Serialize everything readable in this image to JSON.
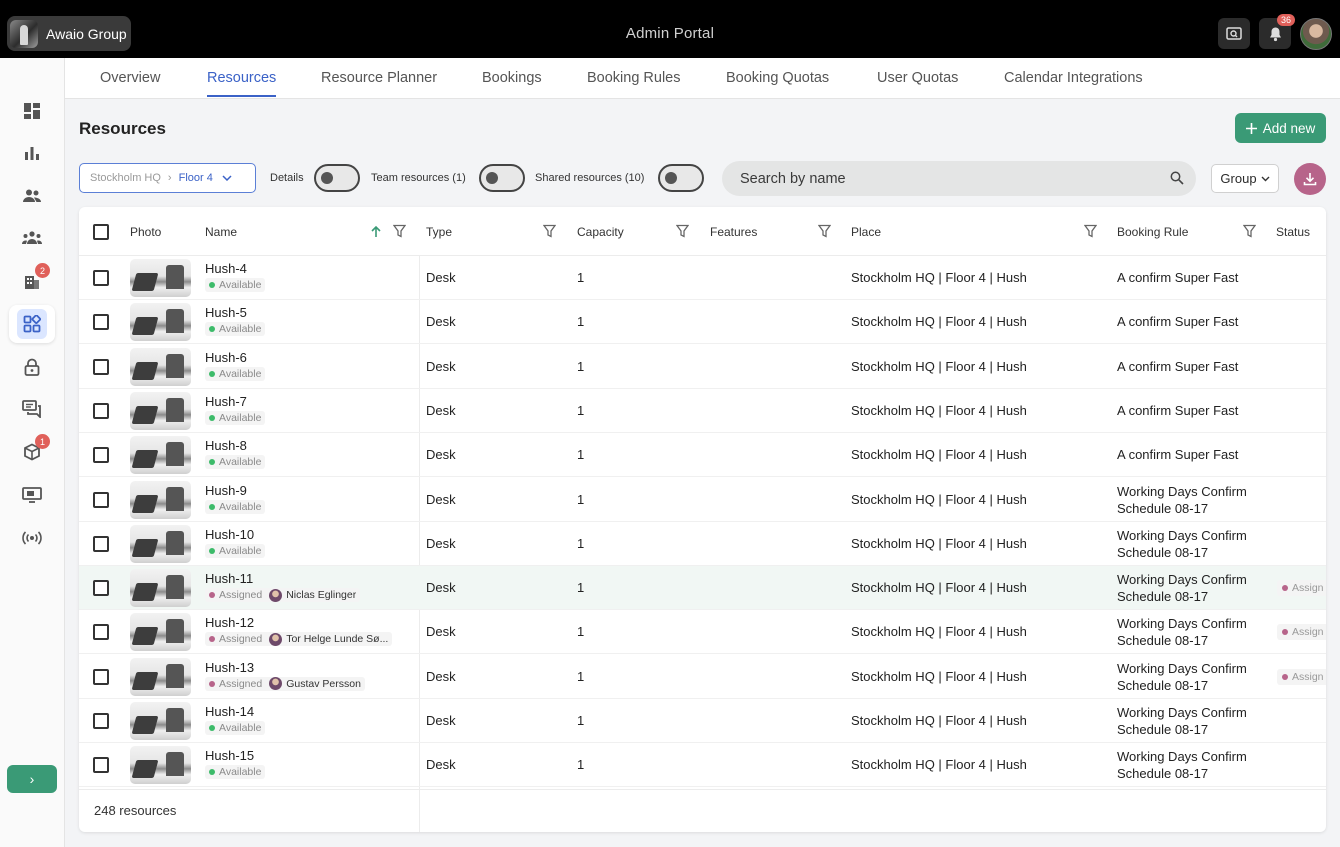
{
  "topbar": {
    "org_name": "Awaio Group",
    "portal_title": "Admin Portal",
    "notification_count": "36"
  },
  "sidebar": {
    "items": [
      {
        "icon": "dashboard-icon"
      },
      {
        "icon": "bar-chart-icon"
      },
      {
        "icon": "users-icon"
      },
      {
        "icon": "team-icon"
      },
      {
        "icon": "building-icon",
        "badge": "2"
      },
      {
        "icon": "resources-icon",
        "active": true
      },
      {
        "icon": "lock-icon"
      },
      {
        "icon": "chat-icon"
      },
      {
        "icon": "package-icon",
        "badge": "1"
      },
      {
        "icon": "screen-icon"
      },
      {
        "icon": "broadcast-icon"
      }
    ],
    "expand_label": "›"
  },
  "tabs": [
    "Overview",
    "Resources",
    "Resource Planner",
    "Bookings",
    "Booking Rules",
    "Booking Quotas",
    "User Quotas",
    "Calendar Integrations"
  ],
  "active_tab": "Resources",
  "page": {
    "title": "Resources",
    "add_new_label": "Add new"
  },
  "filters": {
    "breadcrumb_a": "Stockholm HQ",
    "breadcrumb_b": "Floor 4",
    "details_label": "Details",
    "team_label": "Team resources (1)",
    "shared_label": "Shared resources (10)",
    "search_placeholder": "Search by name",
    "group_label": "Group"
  },
  "table": {
    "columns": {
      "photo": "Photo",
      "name": "Name",
      "type": "Type",
      "capacity": "Capacity",
      "features": "Features",
      "place": "Place",
      "booking_rule": "Booking Rule",
      "status": "Status"
    },
    "rows": [
      {
        "name": "Hush-4",
        "status": "Available",
        "type": "Desk",
        "capacity": "1",
        "place": "Stockholm HQ | Floor 4 | Hush",
        "rule": "A confirm Super Fast"
      },
      {
        "name": "Hush-5",
        "status": "Available",
        "type": "Desk",
        "capacity": "1",
        "place": "Stockholm HQ | Floor 4 | Hush",
        "rule": "A confirm Super Fast"
      },
      {
        "name": "Hush-6",
        "status": "Available",
        "type": "Desk",
        "capacity": "1",
        "place": "Stockholm HQ | Floor 4 | Hush",
        "rule": "A confirm Super Fast"
      },
      {
        "name": "Hush-7",
        "status": "Available",
        "type": "Desk",
        "capacity": "1",
        "place": "Stockholm HQ | Floor 4 | Hush",
        "rule": "A confirm Super Fast"
      },
      {
        "name": "Hush-8",
        "status": "Available",
        "type": "Desk",
        "capacity": "1",
        "place": "Stockholm HQ | Floor 4 | Hush",
        "rule": "A confirm Super Fast"
      },
      {
        "name": "Hush-9",
        "status": "Available",
        "type": "Desk",
        "capacity": "1",
        "place": "Stockholm HQ | Floor 4 | Hush",
        "rule": "Working Days Confirm Schedule 08-17"
      },
      {
        "name": "Hush-10",
        "status": "Available",
        "type": "Desk",
        "capacity": "1",
        "place": "Stockholm HQ | Floor 4 | Hush",
        "rule": "Working Days Confirm Schedule 08-17"
      },
      {
        "name": "Hush-11",
        "status": "Assigned",
        "assignee": "Niclas Eglinger",
        "type": "Desk",
        "capacity": "1",
        "place": "Stockholm HQ | Floor 4 | Hush",
        "rule": "Working Days Confirm Schedule 08-17",
        "status_col": "Assign",
        "highlight": true
      },
      {
        "name": "Hush-12",
        "status": "Assigned",
        "assignee": "Tor Helge Lunde Sø...",
        "type": "Desk",
        "capacity": "1",
        "place": "Stockholm HQ | Floor 4 | Hush",
        "rule": "Working Days Confirm Schedule 08-17",
        "status_col": "Assign"
      },
      {
        "name": "Hush-13",
        "status": "Assigned",
        "assignee": "Gustav Persson",
        "type": "Desk",
        "capacity": "1",
        "place": "Stockholm HQ | Floor 4 | Hush",
        "rule": "Working Days Confirm Schedule 08-17",
        "status_col": "Assign"
      },
      {
        "name": "Hush-14",
        "status": "Available",
        "type": "Desk",
        "capacity": "1",
        "place": "Stockholm HQ | Floor 4 | Hush",
        "rule": "Working Days Confirm Schedule 08-17"
      },
      {
        "name": "Hush-15",
        "status": "Available",
        "type": "Desk",
        "capacity": "1",
        "place": "Stockholm HQ | Floor 4 | Hush",
        "rule": "Working Days Confirm Schedule 08-17"
      }
    ],
    "footer_count": "248 resources"
  },
  "colors": {
    "accent_blue": "#3b62c7",
    "green": "#3a9a76",
    "pink": "#b7648a",
    "badge_red": "#e0605a"
  }
}
